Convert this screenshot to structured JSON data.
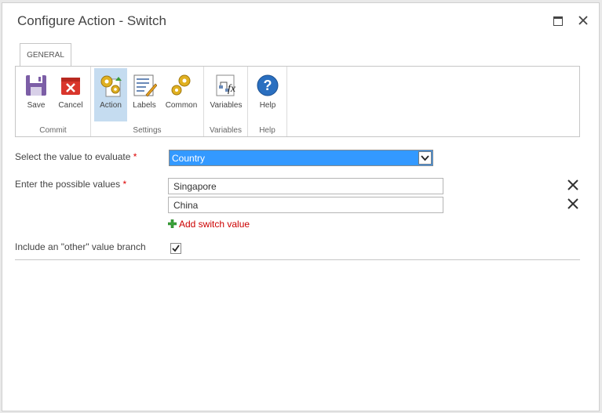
{
  "dialog": {
    "title": "Configure Action - Switch"
  },
  "ribbon": {
    "tab": "GENERAL",
    "groups": [
      {
        "label": "Commit",
        "buttons": [
          {
            "label": "Save",
            "icon": "save-icon"
          },
          {
            "label": "Cancel",
            "icon": "cancel-icon"
          }
        ]
      },
      {
        "label": "Settings",
        "buttons": [
          {
            "label": "Action",
            "icon": "action-gears-icon",
            "selected": true
          },
          {
            "label": "Labels",
            "icon": "labels-icon"
          },
          {
            "label": "Common",
            "icon": "common-gears-icon"
          }
        ]
      },
      {
        "label": "Variables",
        "buttons": [
          {
            "label": "Variables",
            "icon": "variables-fx-icon"
          }
        ]
      },
      {
        "label": "Help",
        "buttons": [
          {
            "label": "Help",
            "icon": "help-icon"
          }
        ]
      }
    ]
  },
  "form": {
    "evaluate_label": "Select the value to evaluate",
    "evaluate_value": "Country",
    "possible_label": "Enter the possible values",
    "required_mark": "*",
    "values": [
      "Singapore",
      "China"
    ],
    "add_label": "Add switch value",
    "other_label": "Include an \"other\" value branch",
    "other_checked": true
  },
  "colors": {
    "selected_bg": "#3399ff",
    "required": "#dd0000",
    "link": "#cc0000",
    "ribbon_selected": "#c5dcf0"
  }
}
